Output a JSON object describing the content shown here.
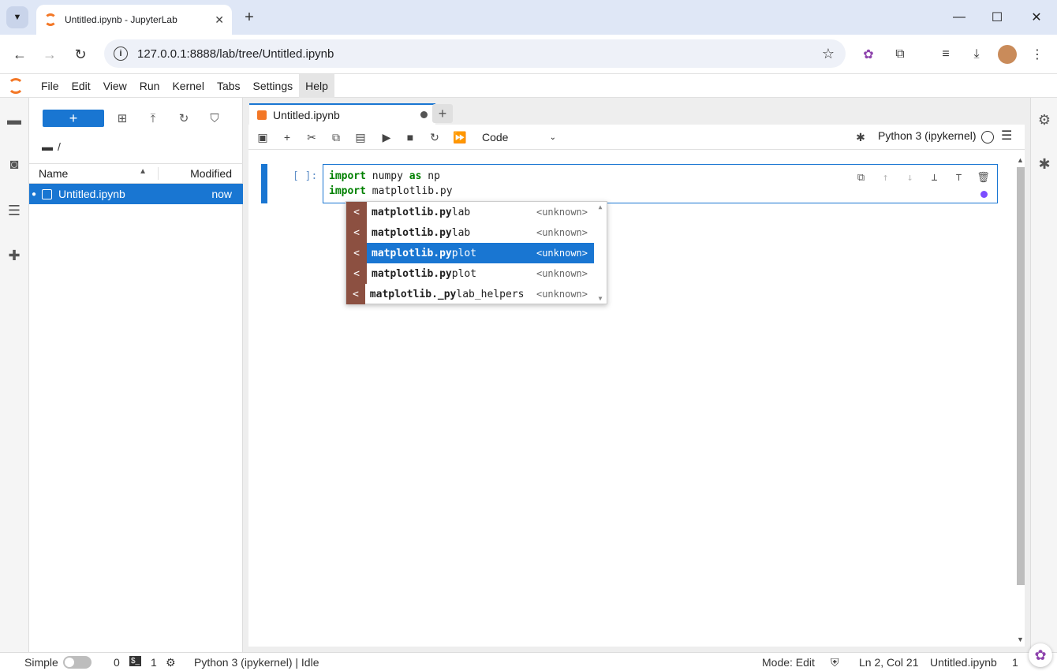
{
  "browser": {
    "tab_title": "Untitled.ipynb - JupyterLab",
    "url": "127.0.0.1:8888/lab/tree/Untitled.ipynb"
  },
  "menubar": {
    "items": [
      "File",
      "Edit",
      "View",
      "Run",
      "Kernel",
      "Tabs",
      "Settings",
      "Help"
    ]
  },
  "filebrowser": {
    "new_label": "+",
    "path": "/",
    "columns": {
      "name": "Name",
      "modified": "Modified"
    },
    "files": [
      {
        "name": "Untitled.ipynb",
        "modified": "now"
      }
    ]
  },
  "notebook": {
    "tab_label": "Untitled.ipynb",
    "cell_type": "Code",
    "kernel": "Python 3 (ipykernel)",
    "cell": {
      "prompt": "[ ]:",
      "line1": {
        "kw1": "import",
        "t1": " numpy ",
        "kw2": "as",
        "t2": " np"
      },
      "line2": {
        "kw1": "import",
        "t1": " matplotlib.py"
      }
    }
  },
  "completer": {
    "items": [
      {
        "type": "<",
        "prefix": "matplotlib.py",
        "rest": "lab",
        "category": "<unknown>"
      },
      {
        "type": "<",
        "prefix": "matplotlib.py",
        "rest": "lab",
        "category": "<unknown>"
      },
      {
        "type": "<",
        "prefix": "matplotlib.py",
        "rest": "plot",
        "category": "<unknown>"
      },
      {
        "type": "<",
        "prefix": "matplotlib.py",
        "rest": "plot",
        "category": "<unknown>"
      },
      {
        "type": "<",
        "prefix": "matplotlib._py",
        "rest": "lab_helpers",
        "category": "<unknown>"
      }
    ],
    "selected_index": 2
  },
  "statusbar": {
    "mode_label": "Simple",
    "terminals": "0",
    "kernels": "1",
    "kernel_status": "Python 3 (ipykernel) | Idle",
    "mode": "Mode: Edit",
    "position": "Ln 2, Col 21",
    "file": "Untitled.ipynb",
    "tail": "1"
  },
  "colors": {
    "accent": "#1976d2",
    "jupyter_orange": "#f37726",
    "completer_type": "#8c5041"
  }
}
